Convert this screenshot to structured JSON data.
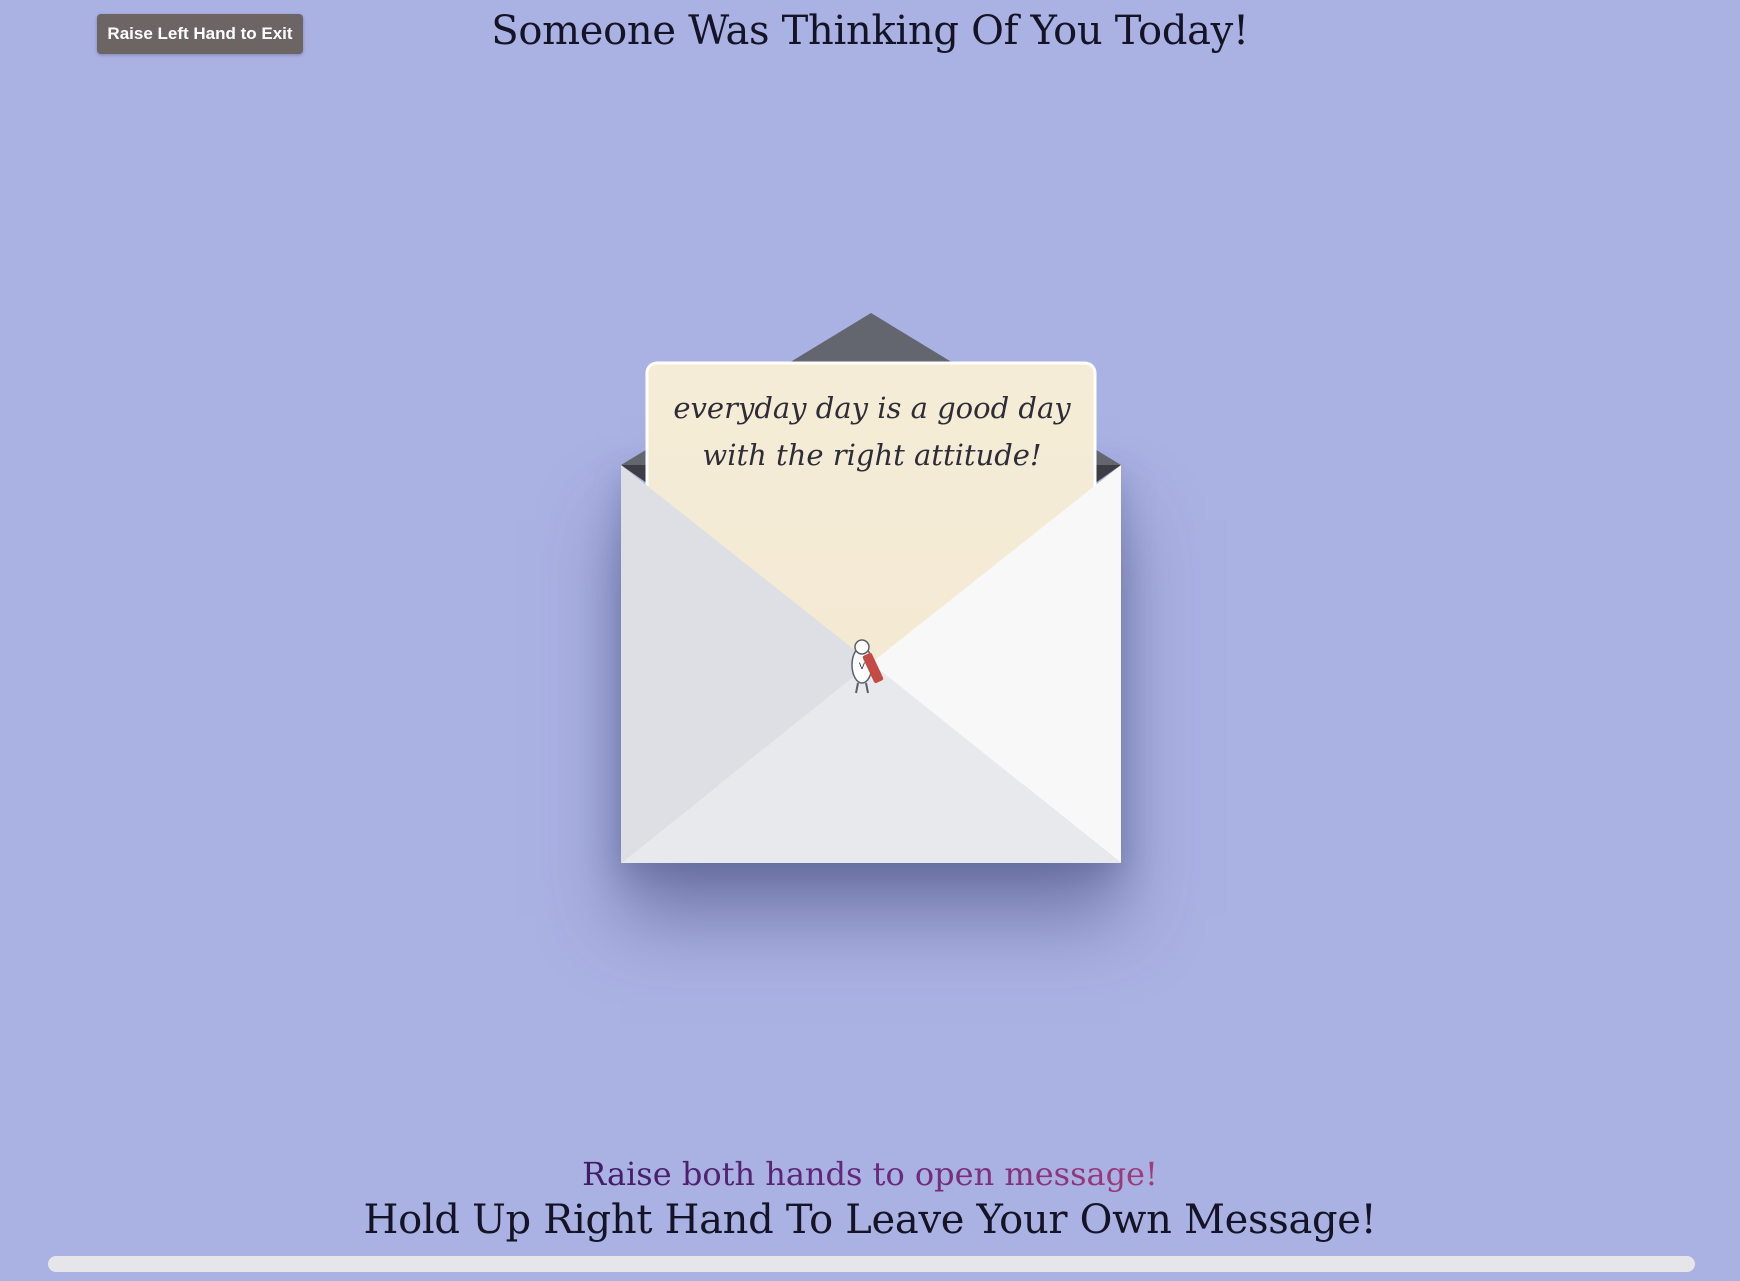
{
  "header": {
    "exit_label": "Raise Left Hand to Exit",
    "title": "Someone Was Thinking Of You Today!"
  },
  "envelope": {
    "letter_line_1": "everyday day is a good day",
    "letter_line_2": "with the right attitude!",
    "seal_icon": "mascot-seal-icon"
  },
  "footer": {
    "open_prompt": "Raise both hands to open message!",
    "leave_message": "Hold Up Right Hand To Leave Your Own Message!",
    "progress": 0
  },
  "colors": {
    "background": "#aab1e3",
    "exit_button": "#6c6564",
    "letter_paper": "#f5ecd7",
    "envelope_flap_dark": "#63656f",
    "prompt_gradient_start": "#3f1c66",
    "prompt_gradient_end": "#a23d7a"
  }
}
